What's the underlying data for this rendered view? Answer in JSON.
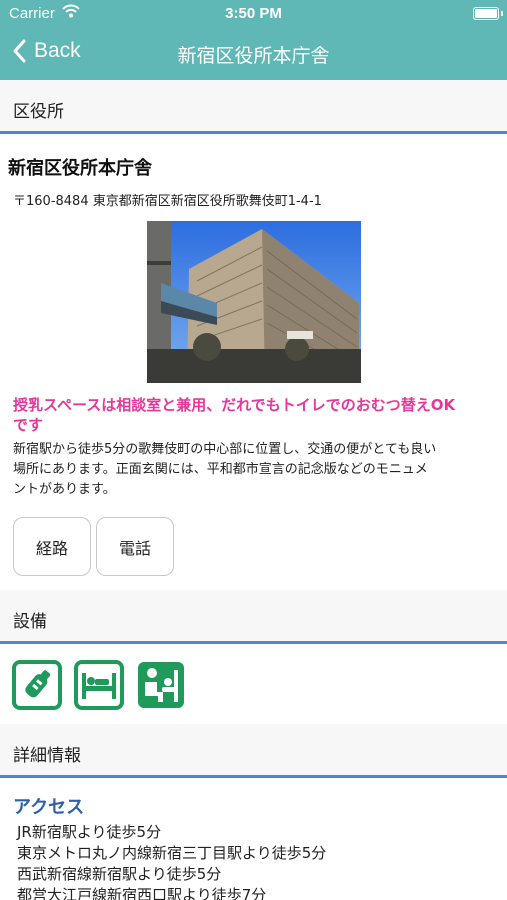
{
  "status_bar": {
    "carrier": "Carrier",
    "time": "3:50 PM"
  },
  "nav": {
    "back_label": "Back",
    "title": "新宿区役所本庁舎"
  },
  "sections": {
    "category": "区役所",
    "facilities": "設備",
    "details": "詳細情報"
  },
  "place": {
    "name": "新宿区役所本庁舎",
    "address": "〒160-8484 東京都新宿区新宿区役所歌舞伎町1-4-1",
    "notice_line1": "授乳スペースは相談室と兼用、だれでもトイレでのおむつ替えOK",
    "notice_line2": "です",
    "description_lines": [
      "新宿駅から徒歩5分の歌舞伎町の中心部に位置し、交通の便がとても良い",
      "場所にあります。正面玄関には、平和都市宣言の記念版などのモニュメ",
      "ントがあります。"
    ]
  },
  "buttons": {
    "route": "経路",
    "phone": "電話"
  },
  "facility_icons": [
    "baby-bottle-icon",
    "diaper-changing-icon",
    "nursing-room-icon"
  ],
  "access": {
    "title": "アクセス",
    "lines": [
      "JR新宿駅より徒歩5分",
      "東京メトロ丸ノ内線新宿三丁目駅より徒歩5分",
      "西武新宿線新宿駅より徒歩5分",
      "都営大江戸線新宿西口駅より徒歩7分"
    ]
  },
  "colors": {
    "nav": "#5fb8b6",
    "divider": "#4f87c7",
    "notice": "#e6389a",
    "icon_green": "#1f9a5a",
    "access_title": "#2f5fa8"
  }
}
